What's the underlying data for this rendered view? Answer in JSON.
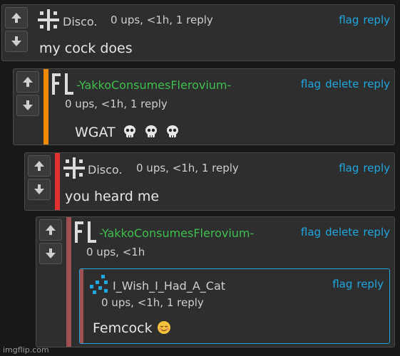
{
  "comments": [
    {
      "username": "Disco.",
      "username_color": "#cfcfcf",
      "meta": "0 ups, <1h, 1 reply",
      "actions": [
        "flag",
        "reply"
      ],
      "text": "my cock does",
      "stripe_color": null
    },
    {
      "username": "-YakkoConsumesFlerovium-",
      "username_color": "#3fbf4f",
      "meta": "0 ups, <1h, 1 reply",
      "actions": [
        "flag",
        "delete",
        "reply"
      ],
      "text": "WGAT",
      "stripe_color": "#f08a00",
      "emoji": "skull-icon x3"
    },
    {
      "username": "Disco.",
      "username_color": "#cfcfcf",
      "meta": "0 ups, <1h, 1 reply",
      "actions": [
        "flag",
        "reply"
      ],
      "text": "you heard me",
      "stripe_color": "#e03030"
    },
    {
      "username": "-YakkoConsumesFlerovium-",
      "username_color": "#3fbf4f",
      "meta": "0 ups, <1h",
      "actions": [
        "flag",
        "delete",
        "reply"
      ],
      "text": "",
      "stripe_color": "#a05050"
    },
    {
      "username": "I_Wish_I_Had_A_Cat",
      "username_color": "#cfcfcf",
      "meta": "0 ups, <1h, 1 reply",
      "actions": [
        "flag",
        "reply"
      ],
      "text": "Femcock",
      "emoji": "relieved-face-icon",
      "stripe_color": "#a05050",
      "border_color": "#1fa7e0"
    }
  ],
  "watermark": "imgflip.com"
}
